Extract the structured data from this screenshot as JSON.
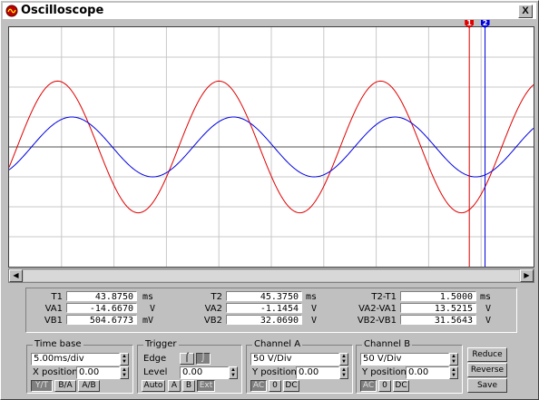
{
  "window": {
    "title": "Oscilloscope",
    "close_label": "X"
  },
  "cursors": {
    "c1_label": "1",
    "c2_label": "2"
  },
  "measurements": {
    "t1": {
      "label": "T1",
      "value": "43.8750",
      "unit": "ms"
    },
    "va1": {
      "label": "VA1",
      "value": "-14.6670",
      "unit": "V"
    },
    "vb1": {
      "label": "VB1",
      "value": "504.6773",
      "unit": "mV"
    },
    "t2": {
      "label": "T2",
      "value": "45.3750",
      "unit": "ms"
    },
    "va2": {
      "label": "VA2",
      "value": "-1.1454",
      "unit": "V"
    },
    "vb2": {
      "label": "VB2",
      "value": "32.0690",
      "unit": "V"
    },
    "dt": {
      "label": "T2-T1",
      "value": "1.5000",
      "unit": "ms"
    },
    "dva": {
      "label": "VA2-VA1",
      "value": "13.5215",
      "unit": "V"
    },
    "dvb": {
      "label": "VB2-VB1",
      "value": "31.5643",
      "unit": "V"
    }
  },
  "timebase": {
    "legend": "Time base",
    "value": "5.00ms/div",
    "xpos_label": "X position",
    "xpos_value": "0.00",
    "modes": [
      "Y/T",
      "B/A",
      "A/B"
    ]
  },
  "trigger": {
    "legend": "Trigger",
    "edge_label": "Edge",
    "level_label": "Level",
    "level_value": "0.00",
    "sources": [
      "Auto",
      "A",
      "B",
      "Ext"
    ]
  },
  "channel_a": {
    "legend": "Channel A",
    "value": "50 V/Div",
    "ypos_label": "Y position",
    "ypos_value": "0.00",
    "coupling": [
      "AC",
      "0",
      "DC"
    ]
  },
  "channel_b": {
    "legend": "Channel B",
    "value": "50 V/Div",
    "ypos_label": "Y position",
    "ypos_value": "0.00",
    "coupling": [
      "AC",
      "0",
      "DC"
    ]
  },
  "actions": {
    "reduce": "Reduce",
    "reverse": "Reverse",
    "save": "Save"
  },
  "colors": {
    "trace_a": "#e00000",
    "trace_b": "#0000e0",
    "grid": "#c8c8c8",
    "center": "#505050"
  },
  "chart_data": {
    "type": "line",
    "x_unit": "ms",
    "x_per_div": 5.0,
    "x_range": [
      0,
      50
    ],
    "y_range": [
      -4,
      4
    ],
    "y_unit": "div",
    "grid": true,
    "series": [
      {
        "amplitude_div": 2.2,
        "period_ms": 15.4,
        "phase_deg": -18
      },
      {
        "amplitude_div": 1.0,
        "period_ms": 15.4,
        "phase_deg": -50
      }
    ],
    "cursor1_ms": 43.875,
    "cursor2_ms": 45.375
  }
}
